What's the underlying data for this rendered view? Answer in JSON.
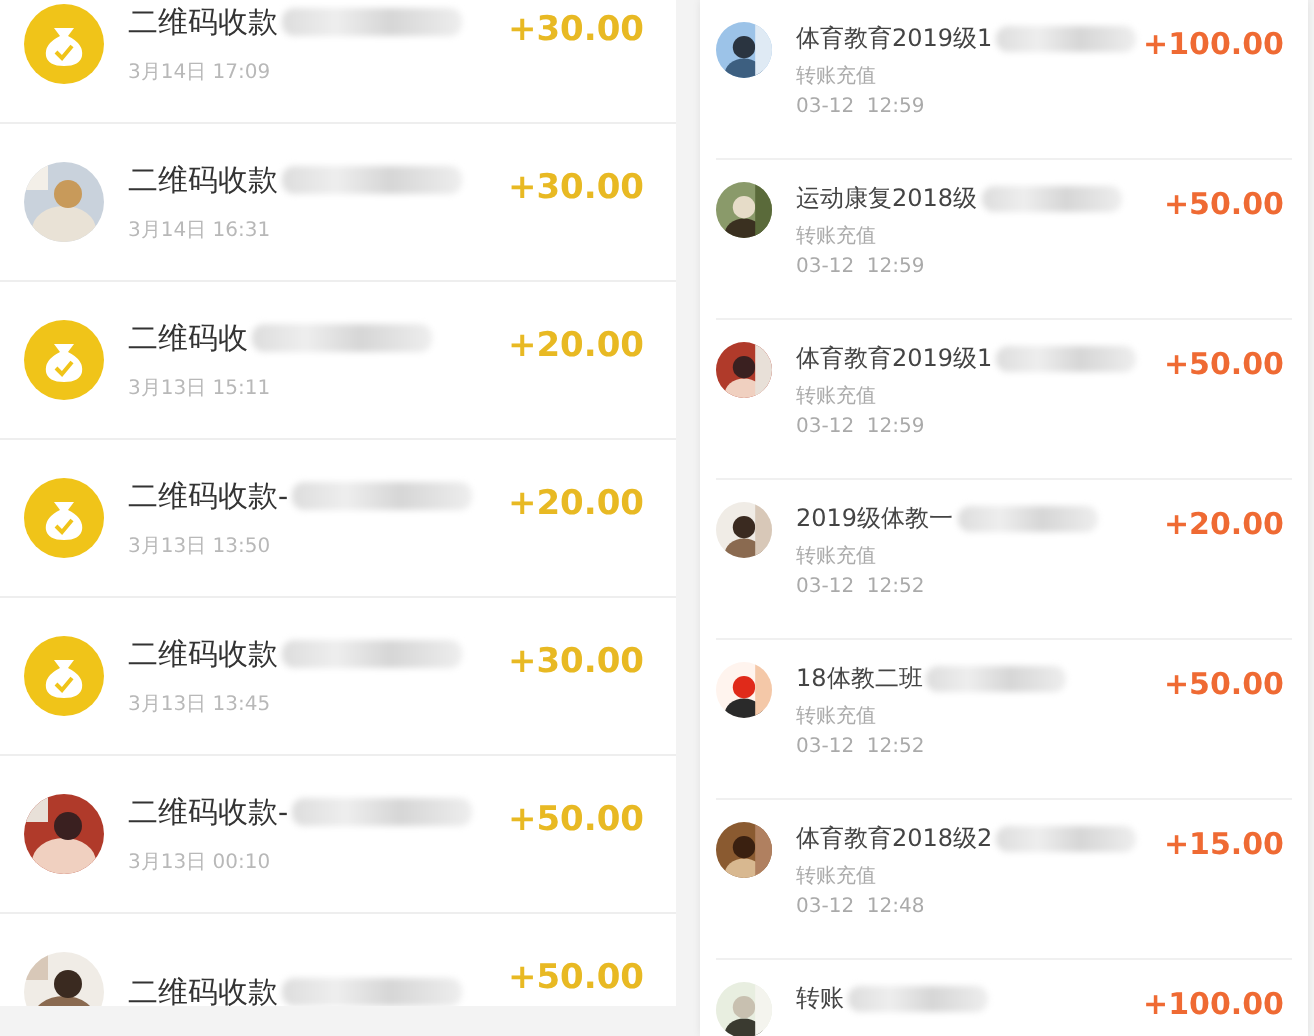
{
  "left_list": [
    {
      "kind": "coin",
      "title": "二维码收款",
      "redacted": true,
      "date": "3月14日 17:09",
      "amount": "+30.00"
    },
    {
      "title": "二维码收款",
      "redacted": true,
      "date": "3月14日 16:31",
      "amount": "+30.00"
    },
    {
      "kind": "coin",
      "title": "二维码收",
      "redacted": true,
      "date": "3月13日 15:11",
      "amount": "+20.00"
    },
    {
      "kind": "coin",
      "title": "二维码收款-",
      "redacted": true,
      "date": "3月13日 13:50",
      "amount": "+20.00"
    },
    {
      "kind": "coin",
      "title": "二维码收款",
      "redacted": true,
      "date": "3月13日 13:45",
      "amount": "+30.00"
    },
    {
      "title": "二维码收款-",
      "redacted": true,
      "date": "3月13日 00:10",
      "amount": "+50.00"
    },
    {
      "title": "二维码收款",
      "redacted": true,
      "amount": "+50.00"
    }
  ],
  "right_list": [
    {
      "title": "体育教育2019级1",
      "redacted": true,
      "type": "转账充值",
      "time": "03-12  12:59",
      "amount": "+100.00"
    },
    {
      "title": "运动康复2018级",
      "redacted": true,
      "type": "转账充值",
      "time": "03-12  12:59",
      "amount": "+50.00"
    },
    {
      "title": "体育教育2019级1",
      "redacted": true,
      "type": "转账充值",
      "time": "03-12  12:59",
      "amount": "+50.00"
    },
    {
      "title": "2019级体教一",
      "redacted": true,
      "type": "转账充值",
      "time": "03-12  12:52",
      "amount": "+20.00"
    },
    {
      "title": "18体教二班",
      "redacted": true,
      "type": "转账充值",
      "time": "03-12  12:52",
      "amount": "+50.00"
    },
    {
      "title": "体育教育2018级2",
      "redacted": true,
      "type": "转账充值",
      "time": "03-12  12:48",
      "amount": "+15.00"
    },
    {
      "title": "转账",
      "redacted": true,
      "amount": "+100.00"
    }
  ]
}
